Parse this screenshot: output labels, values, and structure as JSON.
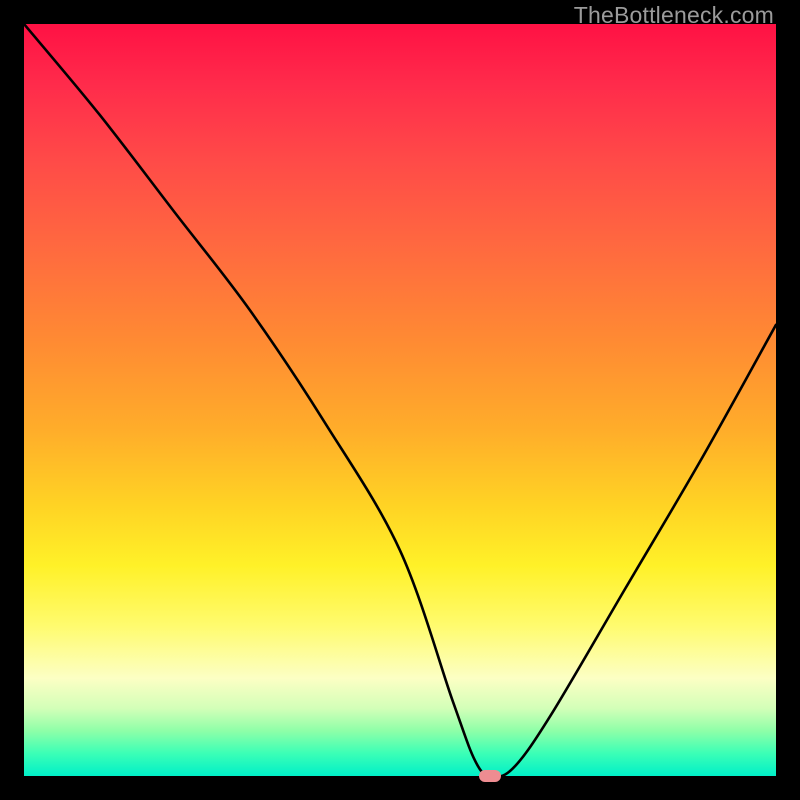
{
  "watermark": "TheBottleneck.com",
  "chart_data": {
    "type": "line",
    "title": "",
    "xlabel": "",
    "ylabel": "",
    "xlim": [
      0,
      100
    ],
    "ylim": [
      0,
      100
    ],
    "x": [
      0,
      10,
      20,
      30,
      40,
      50,
      57,
      60,
      62,
      65,
      70,
      80,
      90,
      100
    ],
    "values": [
      100,
      88,
      75,
      62,
      47,
      30,
      10,
      2,
      0,
      1,
      8,
      25,
      42,
      60
    ],
    "marker": {
      "x": 62,
      "y": 0,
      "color": "#ee8c91"
    },
    "gradient_stops": [
      {
        "pos": 0,
        "color": "#ff1144"
      },
      {
        "pos": 30,
        "color": "#ff6a3f"
      },
      {
        "pos": 64,
        "color": "#ffd324"
      },
      {
        "pos": 87,
        "color": "#fcffc4"
      },
      {
        "pos": 100,
        "color": "#00efc8"
      }
    ]
  }
}
